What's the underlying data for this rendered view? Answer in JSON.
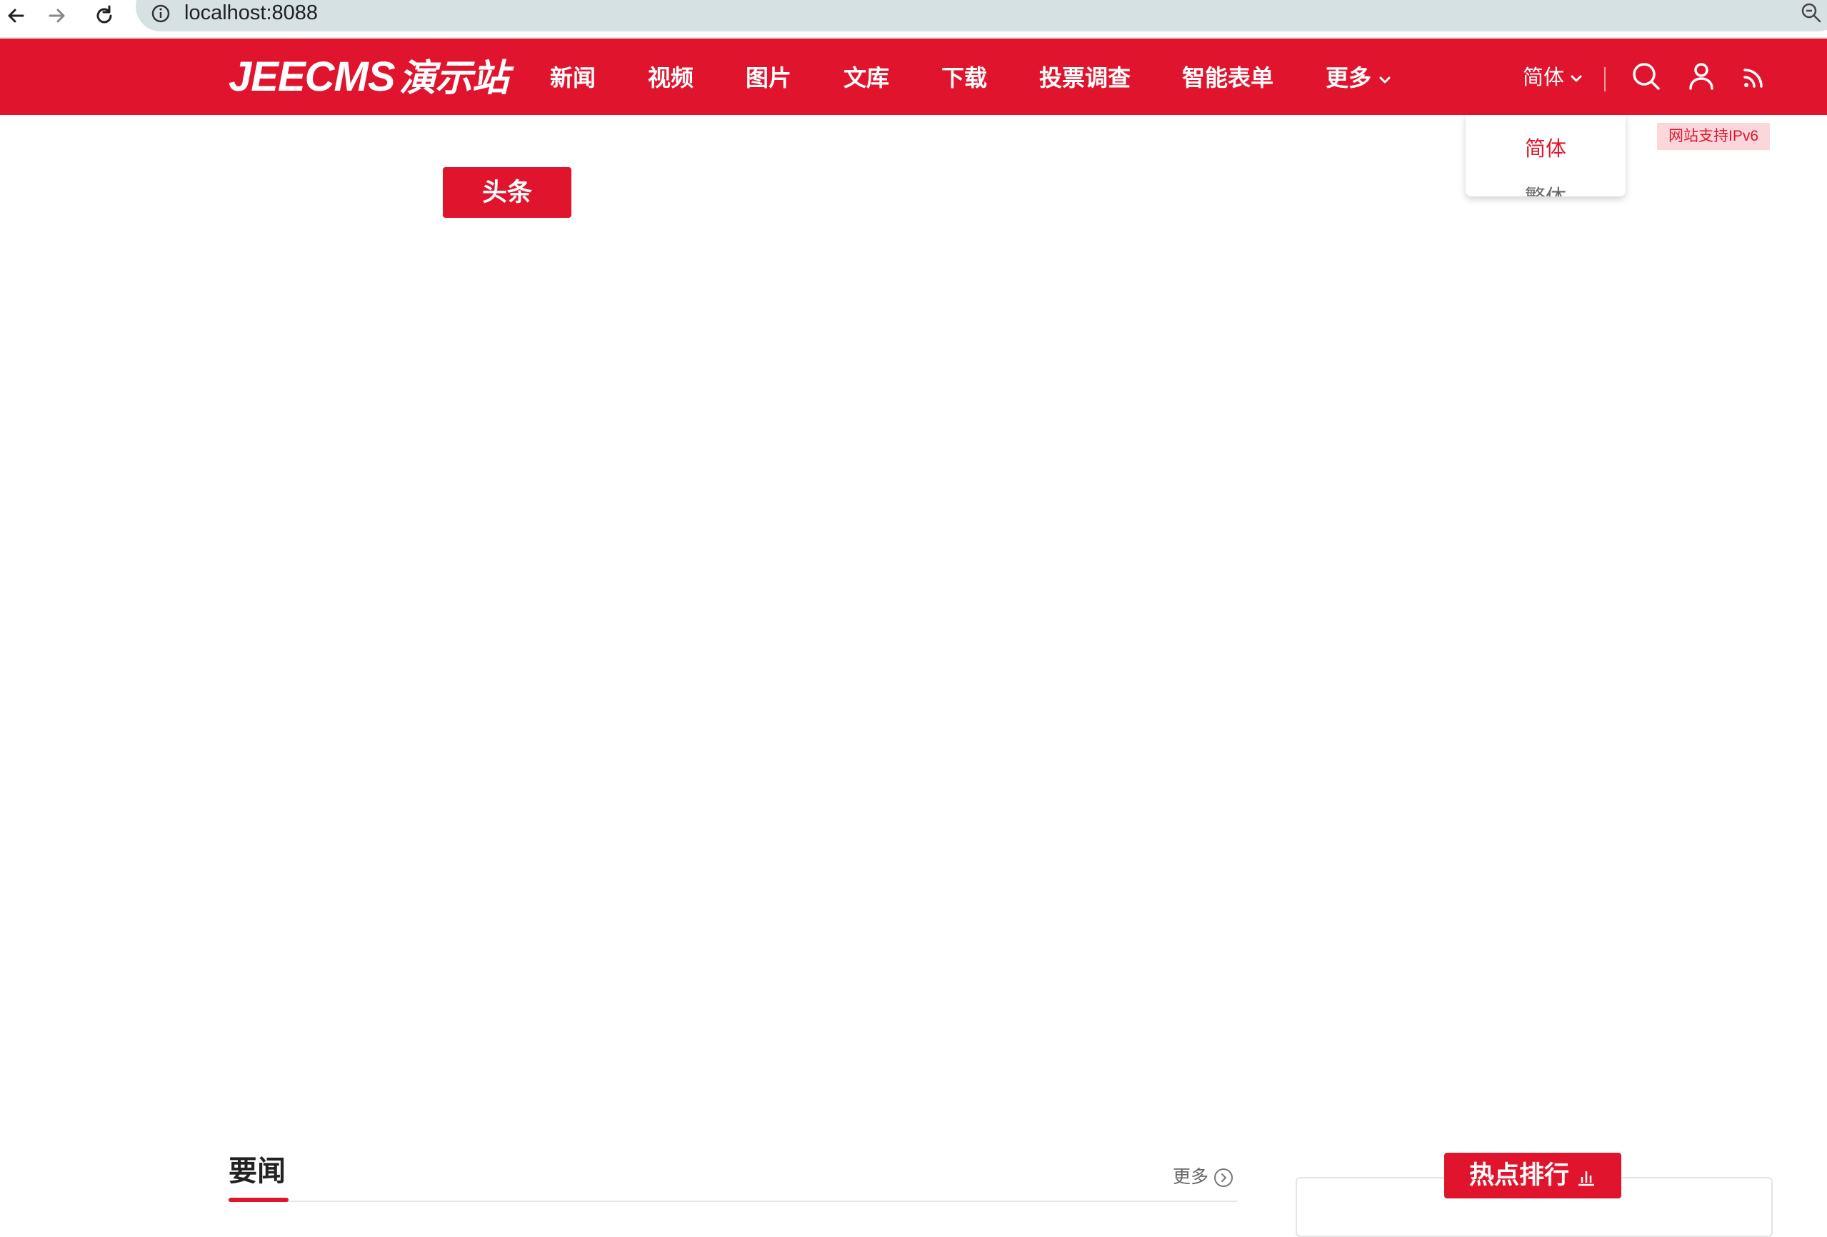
{
  "browser": {
    "url": "localhost:8088",
    "icons": [
      "back-arrow-icon",
      "forward-arrow-icon",
      "reload-icon",
      "info-icon",
      "zoom-icon"
    ]
  },
  "header": {
    "logo_latin": "JEECMS",
    "logo_cn": "演示站",
    "nav": [
      {
        "label": "新闻"
      },
      {
        "label": "视频"
      },
      {
        "label": "图片"
      },
      {
        "label": "文库"
      },
      {
        "label": "下载"
      },
      {
        "label": "投票调查"
      },
      {
        "label": "智能表单"
      },
      {
        "label": "更多"
      }
    ],
    "lang_current": "简体",
    "icons": [
      "search-icon",
      "user-icon",
      "rss-icon"
    ],
    "accent_color": "#e0142c"
  },
  "lang_dropdown": {
    "options": [
      "简体",
      "繁体"
    ]
  },
  "ipv6_badge": "网站支持IPv6",
  "headline_tab": "头条",
  "important_news": {
    "title": "要闻",
    "more_label": "更多"
  },
  "hot_ranking": {
    "title": "热点排行"
  }
}
